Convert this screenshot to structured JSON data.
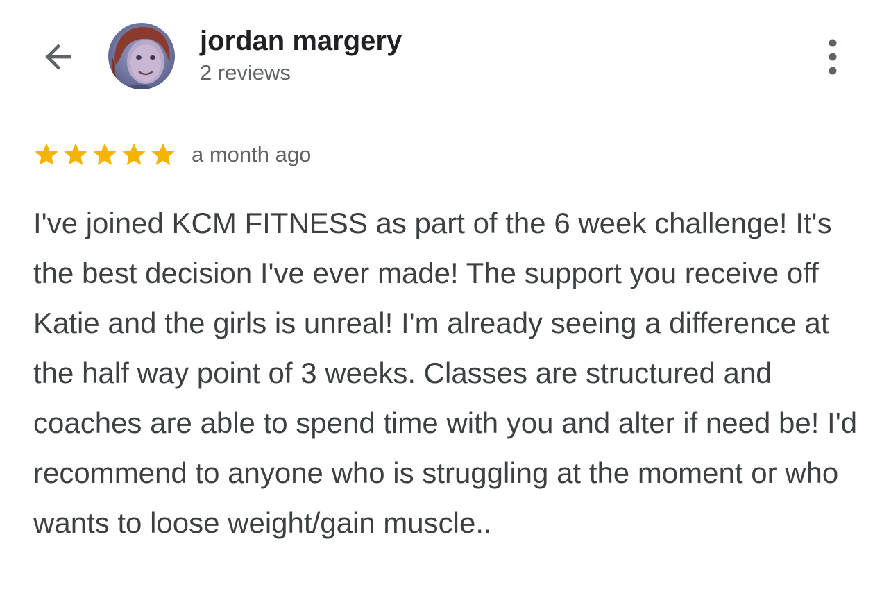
{
  "reviewer": {
    "name": "jordan margery",
    "reviews_count": "2 reviews"
  },
  "review": {
    "rating": 5,
    "max_rating": 5,
    "time": "a month ago",
    "text": "I've joined KCM FITNESS as part of the 6 week challenge! It's the best decision I've ever made! The support you receive off Katie and the girls is unreal! I'm already seeing a difference at the half way point of 3 weeks. Classes are structured and coaches are able to spend time with you and alter if need be! I'd recommend to anyone who is struggling at the moment or who wants to loose weight/gain muscle.."
  },
  "icons": {
    "back": "arrow-back-icon",
    "more": "more-vert-icon",
    "star": "star-icon"
  },
  "colors": {
    "star": "#f4b400",
    "name": "#202124",
    "secondary_text": "#5f6368",
    "body_text": "#3c4043"
  }
}
